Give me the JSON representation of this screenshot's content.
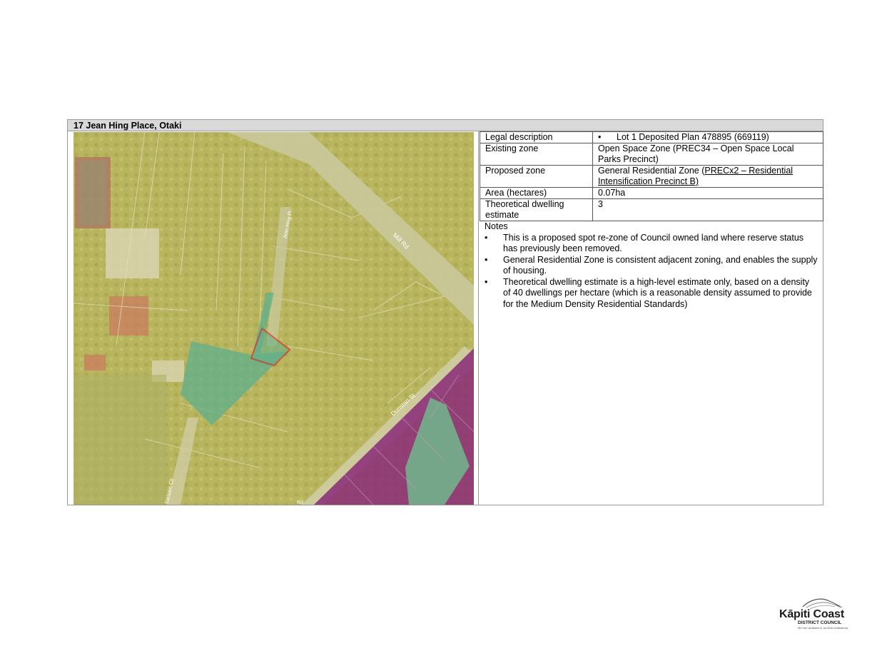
{
  "title": "17 Jean Hing Place, Otaki",
  "map": {
    "street_labels": [
      "Mill Rd",
      "Jean Hing Pl",
      "Dunstan St",
      "Nelsen Ct",
      "Rd"
    ],
    "colors": {
      "residential": "#b5b55a",
      "open_space": "#5fb08c",
      "commercial": "#8a2a78",
      "parcel_highlight": "#e0141e"
    }
  },
  "table": {
    "legal_label": "Legal description",
    "legal_value": "Lot 1 Deposited Plan 478895 (669119)",
    "existing_label": "Existing zone",
    "existing_value": "Open Space Zone (PREC34 – Open Space Local Parks Precinct)",
    "proposed_label": "Proposed zone",
    "proposed_value_a": "General Residential Zone (",
    "proposed_value_b": "PRECx2 – Residential Intensification Precinct B)",
    "area_label": "Area (hectares)",
    "area_value": "0.07ha",
    "dwelling_label": "Theoretical dwelling estimate",
    "dwelling_value": "3"
  },
  "notes": {
    "heading": "Notes",
    "items": [
      "This is a proposed spot re-zone of Council owned land where reserve status has previously been removed.",
      "General Residential Zone is consistent adjacent zoning, and enables the supply of housing.",
      "Theoretical dwelling estimate is a high-level estimate only, based on a density of 40 dwellings per hectare (which is a reasonable density assumed to provide for the Medium Density Residential Standards)"
    ]
  },
  "logo": {
    "name": "Kāpiti Coast",
    "sub": "DISTRICT COUNCIL",
    "tagline": "Me huri whakamuri, ka titoki whakamua"
  }
}
